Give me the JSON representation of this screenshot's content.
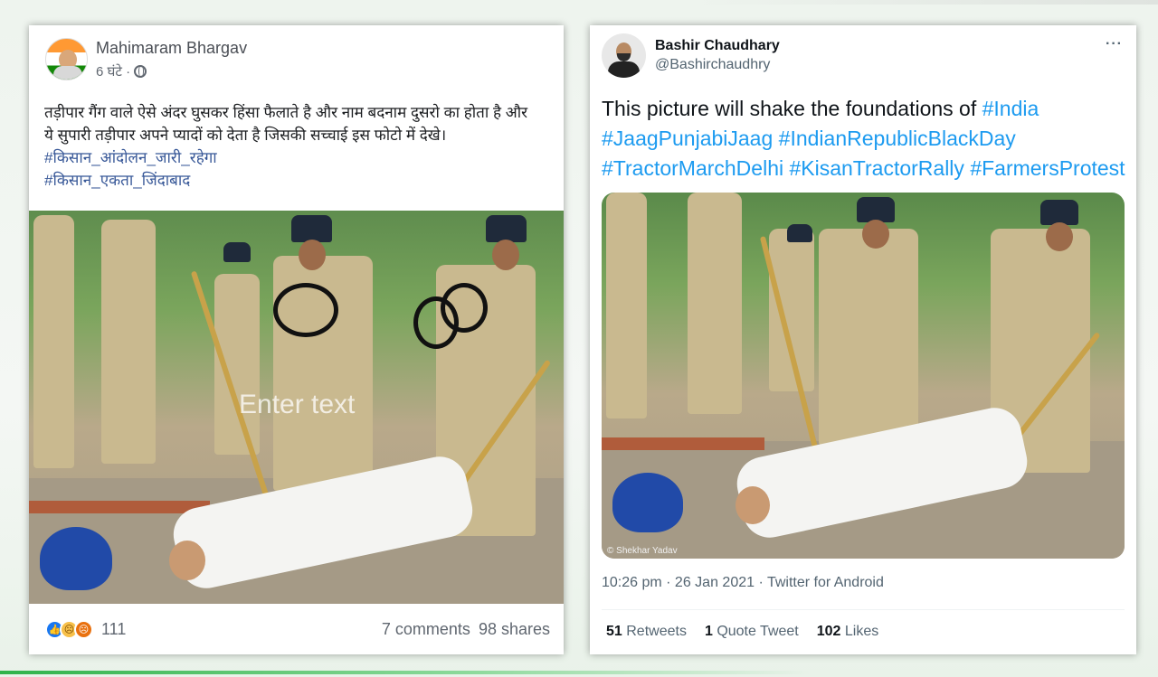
{
  "facebook_post": {
    "author": "Mahimaram Bhargav",
    "time": "6 घंटे ·",
    "text_lines": [
      "तड़ीपार गैंग वाले ऐसे अंदर घुसकर हिंसा फैलाते है और नाम बदनाम दुसरो का होता है और",
      "ये सुपारी तड़ीपार अपने प्यादों को देता है जिसकी सच्चाई इस फोटो में देखे।"
    ],
    "hashtags": [
      "#किसान_आंदोलन_जारी_रहेगा",
      "#किसान_एकता_जिंदाबाद"
    ],
    "image_overlay_text": "Enter text",
    "reaction_count": "111",
    "comments": "7 comments",
    "shares": "98 shares",
    "reaction_icons": [
      "like-icon",
      "sad-icon",
      "angry-icon"
    ]
  },
  "tweet": {
    "name": "Bashir Chaudhary",
    "handle": "@Bashirchaudhry",
    "text_plain": "This picture will shake the foundations of ",
    "hashtags": [
      "#India",
      "#JaagPunjabiJaag",
      "#IndianRepublicBlackDay",
      "#TractorMarchDelhi",
      "#KisanTractorRally",
      "#FarmersProtest"
    ],
    "image_credit": "© Shekhar Yadav",
    "datetime": "10:26 pm · 26 Jan 2021 · Twitter for Android",
    "retweets_count": "51",
    "retweets_label": "Retweets",
    "quote_count": "1",
    "quote_label": "Quote Tweet",
    "likes_count": "102",
    "likes_label": "Likes",
    "more_icon": "more-dots-icon"
  },
  "colors": {
    "twitter_blue": "#1d9bf0",
    "facebook_link": "#385898",
    "facebook_like": "#1877f2"
  }
}
